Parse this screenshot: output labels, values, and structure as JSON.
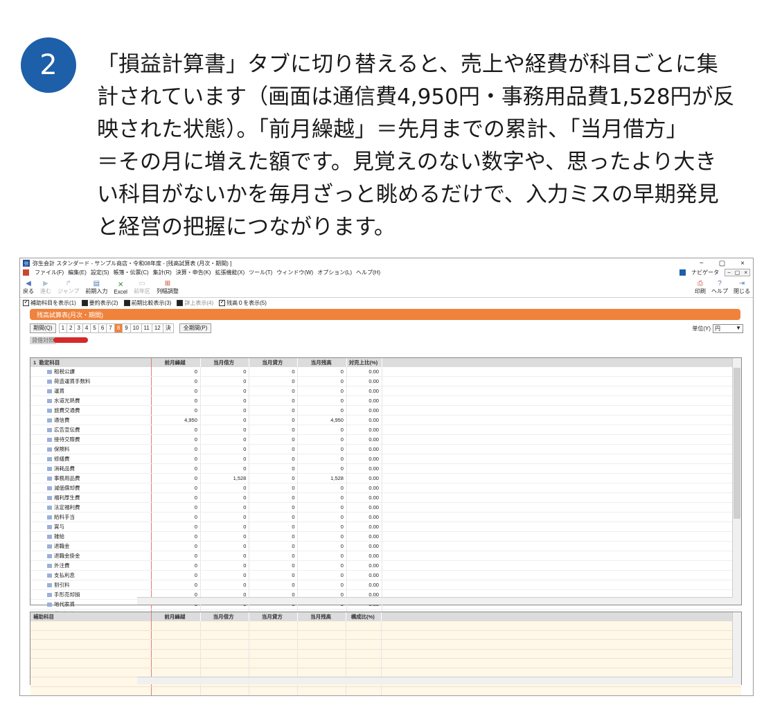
{
  "step": {
    "number": "2"
  },
  "instruction": "「損益計算書」タブに切り替えると、売上や経費が科目ごとに集\n計されています（画面は通信費4,950円・事務用品費1,528円が反\n映された状態）。「前月繰越」＝先月までの累計、「当月借方」\n＝その月に増えた額です。見覚えのない数字や、思ったより大き\nい科目がないかを毎月ざっと眺めるだけで、入力ミスの早期発見\nと経営の把握につながります。",
  "window": {
    "title": "弥生会計 スタンダード - サンプル商店・令和08年度 - [残高試算表 (月次・期間) ]",
    "controls": [
      "−",
      "▢",
      "×"
    ],
    "menu": [
      "ファイル(F)",
      "編集(E)",
      "設定(S)",
      "帳簿・伝票(C)",
      "集計(R)",
      "決算・申告(K)",
      "拡張機能(X)",
      "ツール(T)",
      "ウィンドウ(W)",
      "オプション(L)",
      "ヘルプ(H)"
    ],
    "navigator": "ナビゲータ"
  },
  "toolbar": {
    "left": [
      {
        "label": "戻る",
        "icon": "back-arrow-icon",
        "enabled": true
      },
      {
        "label": "進む",
        "icon": "forward-arrow-icon",
        "enabled": false
      },
      {
        "label": "ジャンプ",
        "icon": "jump-icon",
        "enabled": false
      },
      {
        "label": "前期入力",
        "icon": "prev-input-icon",
        "enabled": true
      },
      {
        "label": "Excel",
        "icon": "excel-icon",
        "enabled": true
      },
      {
        "label": "前年区",
        "icon": "prev-year-icon",
        "enabled": false
      },
      {
        "label": "列幅調整",
        "icon": "column-width-icon",
        "enabled": true
      }
    ],
    "right": [
      {
        "label": "印刷",
        "icon": "print-icon"
      },
      {
        "label": "ヘルプ",
        "icon": "help-icon"
      },
      {
        "label": "閉じる",
        "icon": "close-icon"
      }
    ]
  },
  "options": [
    {
      "label": "補助科目を表示(1)",
      "checked": true
    },
    {
      "label": "要約表示(2)",
      "checked": false
    },
    {
      "label": "前期比較表示(3)",
      "checked": false
    },
    {
      "label": "詳上表示(4)",
      "checked": false
    },
    {
      "label": "残高０を表示(5)",
      "checked": true
    }
  ],
  "report": {
    "title": "残高試算表(月次・期間)"
  },
  "period": {
    "button": "期間(Q)",
    "months": [
      "1",
      "2",
      "3",
      "4",
      "5",
      "6",
      "7",
      "8",
      "9",
      "10",
      "11",
      "12",
      "決"
    ],
    "selected": "8",
    "all_button": "全期間(P)",
    "unit_label": "単位(Y)",
    "unit_value": "円"
  },
  "tab": {
    "label": "貸借対照"
  },
  "table": {
    "headers": [
      "勘定科目",
      "前月繰越",
      "当月借方",
      "当月貸方",
      "当月残高",
      "対売上比(%)"
    ],
    "header_index": "1",
    "rows": [
      [
        "租税公課",
        "0",
        "0",
        "0",
        "0",
        "0.00"
      ],
      [
        "荷造運賃手数料",
        "0",
        "0",
        "0",
        "0",
        "0.00"
      ],
      [
        "運賃",
        "0",
        "0",
        "0",
        "0",
        "0.00"
      ],
      [
        "水道光熱費",
        "0",
        "0",
        "0",
        "0",
        "0.00"
      ],
      [
        "旅費交通費",
        "0",
        "0",
        "0",
        "0",
        "0.00"
      ],
      [
        "通信費",
        "4,950",
        "0",
        "0",
        "4,950",
        "0.00"
      ],
      [
        "広告宣伝費",
        "0",
        "0",
        "0",
        "0",
        "0.00"
      ],
      [
        "接待交際費",
        "0",
        "0",
        "0",
        "0",
        "0.00"
      ],
      [
        "保険料",
        "0",
        "0",
        "0",
        "0",
        "0.00"
      ],
      [
        "修繕費",
        "0",
        "0",
        "0",
        "0",
        "0.00"
      ],
      [
        "消耗品費",
        "0",
        "0",
        "0",
        "0",
        "0.00"
      ],
      [
        "事務用品費",
        "0",
        "1,528",
        "0",
        "1,528",
        "0.00"
      ],
      [
        "減価償却費",
        "0",
        "0",
        "0",
        "0",
        "0.00"
      ],
      [
        "福利厚生費",
        "0",
        "0",
        "0",
        "0",
        "0.00"
      ],
      [
        "法定福利費",
        "0",
        "0",
        "0",
        "0",
        "0.00"
      ],
      [
        "給料手当",
        "0",
        "0",
        "0",
        "0",
        "0.00"
      ],
      [
        "賞与",
        "0",
        "0",
        "0",
        "0",
        "0.00"
      ],
      [
        "雑給",
        "0",
        "0",
        "0",
        "0",
        "0.00"
      ],
      [
        "退職金",
        "0",
        "0",
        "0",
        "0",
        "0.00"
      ],
      [
        "退職金掛金",
        "0",
        "0",
        "0",
        "0",
        "0.00"
      ],
      [
        "外注費",
        "0",
        "0",
        "0",
        "0",
        "0.00"
      ],
      [
        "支払利息",
        "0",
        "0",
        "0",
        "0",
        "0.00"
      ],
      [
        "割引料",
        "0",
        "0",
        "0",
        "0",
        "0.00"
      ],
      [
        "手形売却損",
        "0",
        "0",
        "0",
        "0",
        "0.00"
      ],
      [
        "地代家賃",
        "0",
        "0",
        "0",
        "0",
        "0.00"
      ],
      [
        "貸倒損失",
        "0",
        "0",
        "0",
        "0",
        "0.00"
      ],
      [
        "支払手数料",
        "0",
        "0",
        "0",
        "0",
        "0.00"
      ]
    ]
  },
  "sub_table": {
    "headers": [
      "補助科目",
      "前月繰越",
      "当月借方",
      "当月貸方",
      "当月残高",
      "構成比(%)"
    ],
    "empty_rows": 8
  }
}
